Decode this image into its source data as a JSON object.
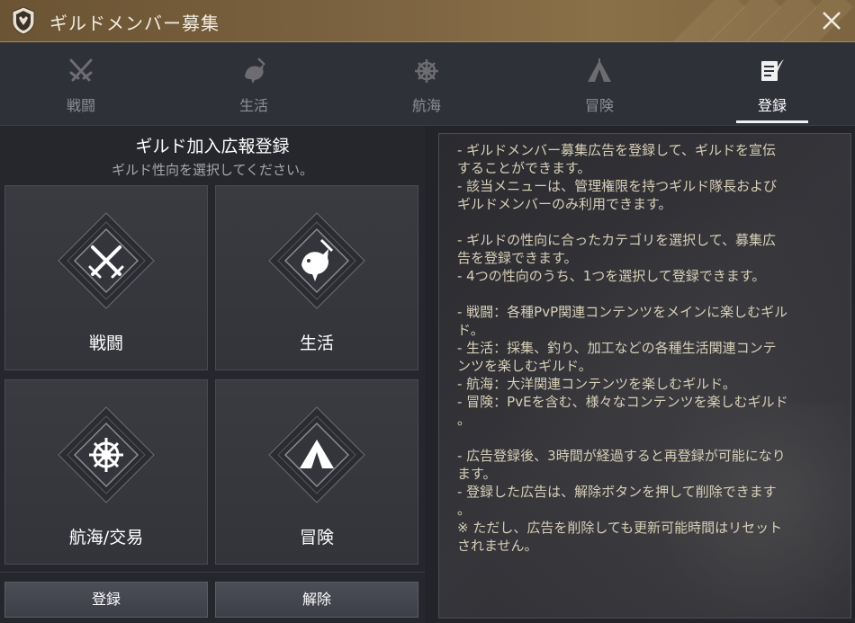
{
  "window": {
    "title": "ギルドメンバー募集"
  },
  "tabs": [
    {
      "label": "戦闘",
      "icon": "crossed-swords-icon",
      "active": false
    },
    {
      "label": "生活",
      "icon": "fish-pickaxe-icon",
      "active": false
    },
    {
      "label": "航海",
      "icon": "ship-wheel-icon",
      "active": false
    },
    {
      "label": "冒険",
      "icon": "tent-icon",
      "active": false
    },
    {
      "label": "登録",
      "icon": "document-quill-icon",
      "active": true
    }
  ],
  "register": {
    "title": "ギルド加入広報登録",
    "subtitle": "ギルド性向を選択してください。",
    "cards": [
      {
        "label": "戦闘",
        "icon": "crossed-swords-icon"
      },
      {
        "label": "生活",
        "icon": "fish-pickaxe-icon"
      },
      {
        "label": "航海/交易",
        "icon": "ship-wheel-icon"
      },
      {
        "label": "冒険",
        "icon": "tent-icon"
      }
    ],
    "register_button": "登録",
    "remove_button": "解除"
  },
  "description": {
    "lines": [
      "- ギルドメンバー募集広告を登録して、ギルドを宣伝",
      "することができます。",
      "- 該当メニューは、管理権限を持つギルド隊長および",
      "ギルドメンバーのみ利用できます。",
      "",
      "- ギルドの性向に合ったカテゴリを選択して、募集広",
      "告を登録できます。",
      "- 4つの性向のうち、1つを選択して登録できます。",
      "",
      "- 戦闘：各種PvP関連コンテンツをメインに楽しむギル",
      "ド。",
      "- 生活：採集、釣り、加工などの各種生活関連コンテ",
      "ンツを楽しむギルド。",
      "- 航海：大洋関連コンテンツを楽しむギルド。",
      "- 冒険：PvEを含む、様々なコンテンツを楽しむギルド",
      "。",
      "",
      "- 広告登録後、3時間が経過すると再登録が可能になり",
      "ます。",
      "- 登録した広告は、解除ボタンを押して削除できます",
      "。",
      "※ ただし、広告を削除しても更新可能時間はリセット",
      "されません。"
    ]
  },
  "colors": {
    "title_bar": "#7a6140",
    "text_description": "#d8cfb8",
    "tab_inactive": "#8e8e93",
    "tab_active": "#ffffff"
  }
}
